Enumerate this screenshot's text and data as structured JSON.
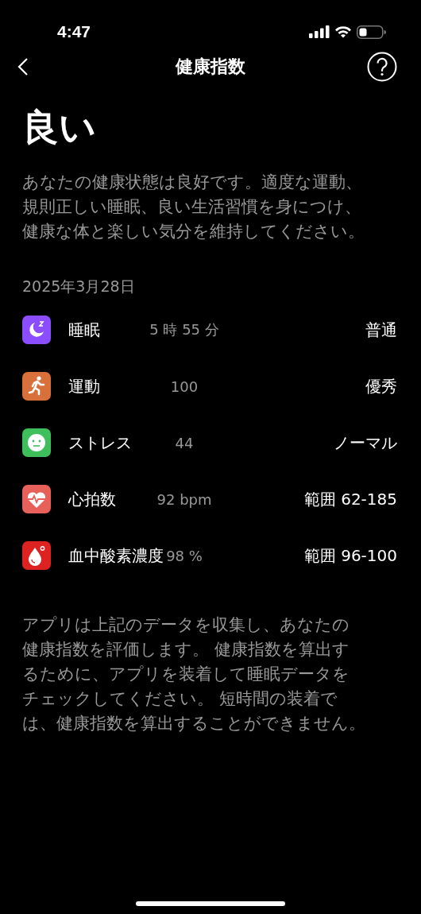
{
  "status_bar": {
    "time": "4:47"
  },
  "nav": {
    "title": "健康指数"
  },
  "rating": "良い",
  "description": "あなたの健康状態は良好です。適度な運動、規則正しい睡眠、良い生活習慣を身につけ、健康な体と楽しい気分を維持してください。",
  "date": "2025年3月28日",
  "metrics": [
    {
      "kind": "sleep",
      "color": "#8b4dff",
      "label": "睡眠",
      "value": "5 時 55 分",
      "result": "普通"
    },
    {
      "kind": "exercise",
      "color": "#d8703c",
      "label": "運動",
      "value": "100",
      "result": "優秀"
    },
    {
      "kind": "stress",
      "color": "#3fbf5c",
      "label": "ストレス",
      "value": "44",
      "result": "ノーマル"
    },
    {
      "kind": "heart",
      "color": "#e8605a",
      "label": "心拍数",
      "value": "92 bpm",
      "result": "範囲 62-185"
    },
    {
      "kind": "oxygen",
      "color": "#dd2222",
      "label": "血中酸素濃度",
      "value": "98 %",
      "result": "範囲 96-100"
    }
  ],
  "note": "アプリは上記のデータを収集し、あなたの健康指数を評価します。 健康指数を算出するために、アプリを装着して睡眠データをチェックしてください。 短時間の装着では、健康指数を算出することができません。"
}
